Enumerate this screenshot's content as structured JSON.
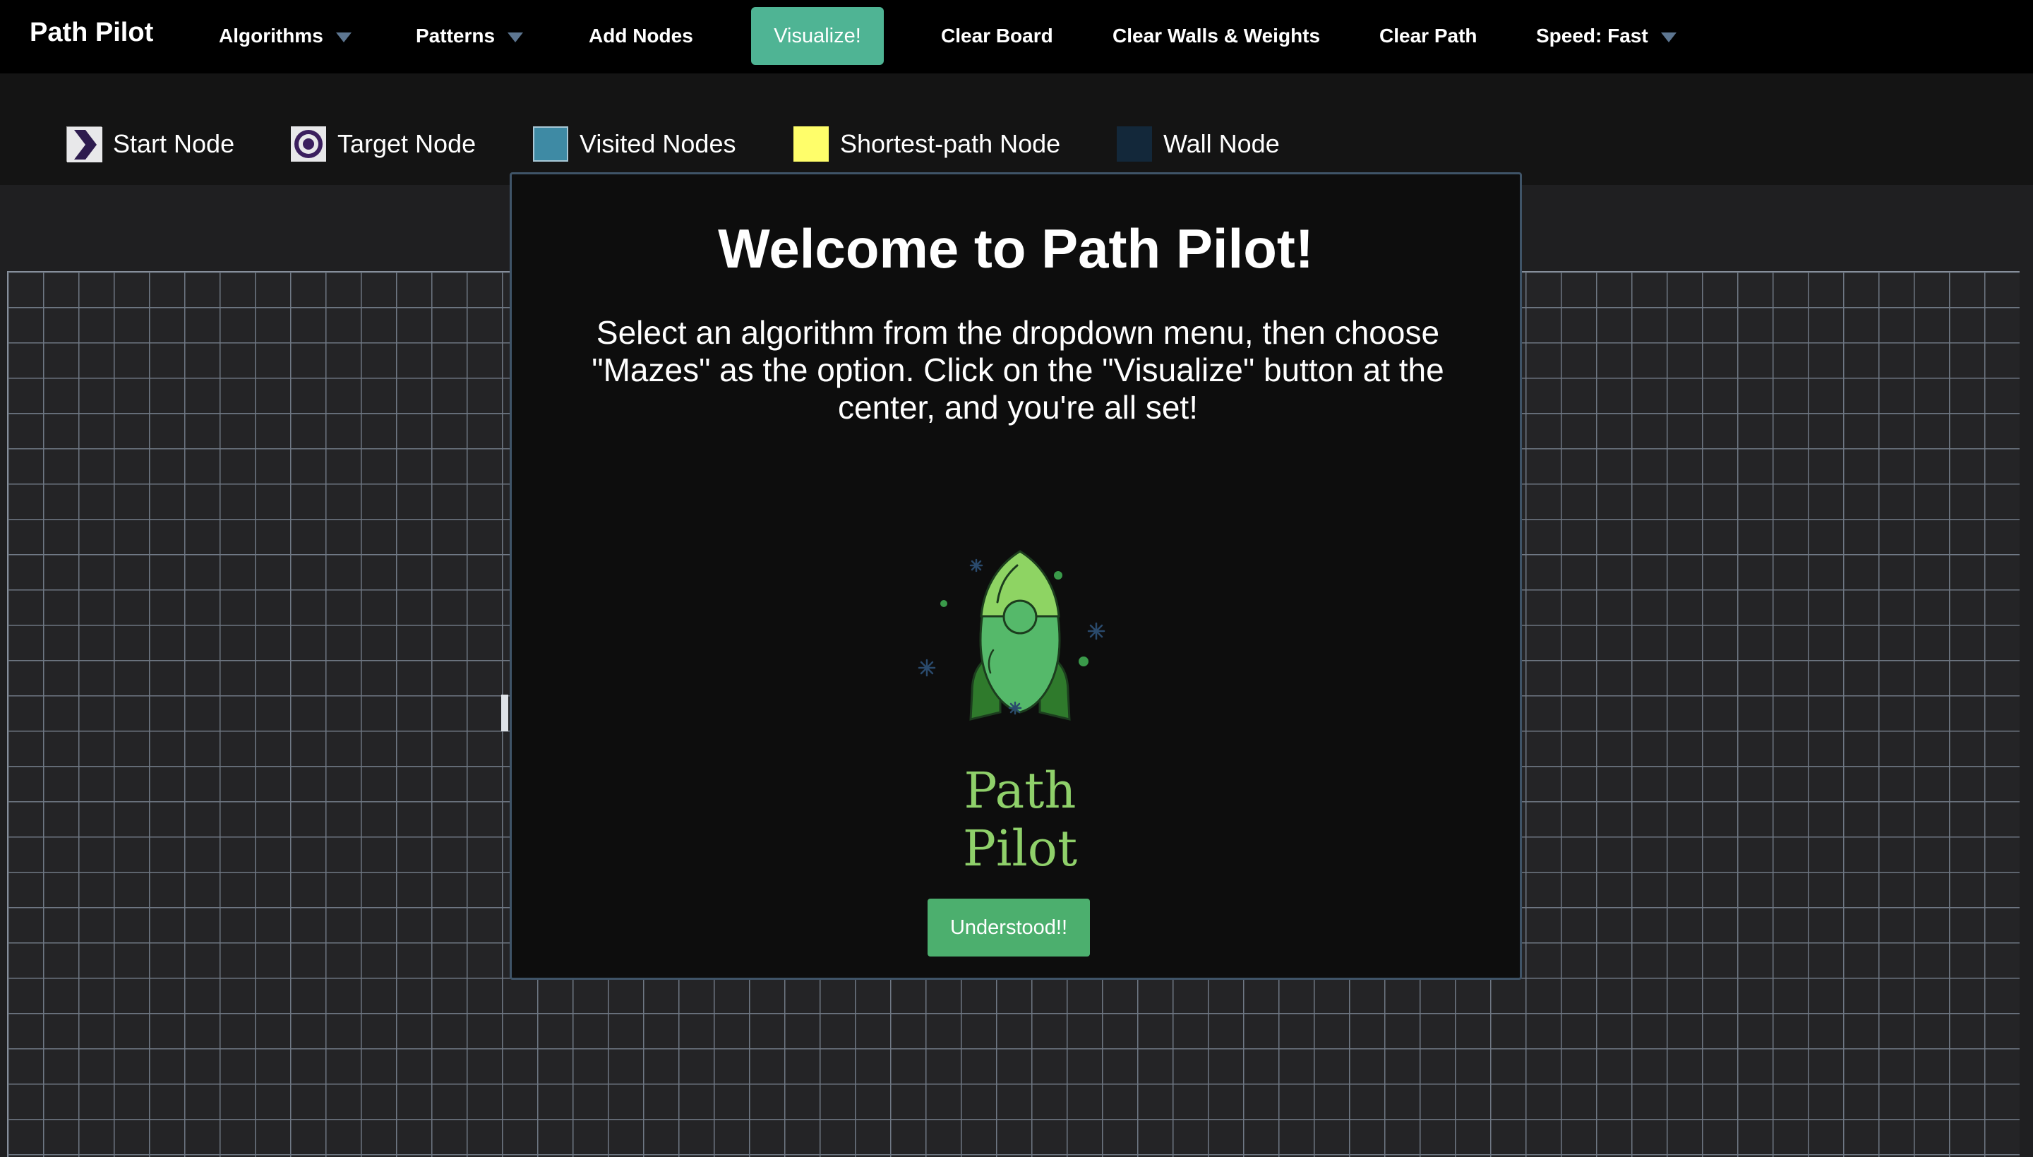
{
  "navbar": {
    "brand": "Path Pilot",
    "items": [
      {
        "label": "Algorithms",
        "dropdown": true
      },
      {
        "label": "Patterns",
        "dropdown": true
      },
      {
        "label": "Add Nodes",
        "dropdown": false
      },
      {
        "label": "Clear Board",
        "dropdown": false
      },
      {
        "label": "Clear Walls & Weights",
        "dropdown": false
      },
      {
        "label": "Clear Path",
        "dropdown": false
      },
      {
        "label": "Speed: Fast",
        "dropdown": true
      }
    ],
    "visualize_label": "Visualize!"
  },
  "legend": [
    {
      "label": "Start Node",
      "icon": "chevron-right-icon",
      "color": "#2d1b4e"
    },
    {
      "label": "Target Node",
      "icon": "target-icon",
      "color": "#3b1f5e"
    },
    {
      "label": "Visited Nodes",
      "icon": "square",
      "color": "#3e8aa4"
    },
    {
      "label": "Shortest-path Node",
      "icon": "square",
      "color": "#fffe6a"
    },
    {
      "label": "Wall Node",
      "icon": "square",
      "color": "#13283a"
    }
  ],
  "modal": {
    "title": "Welcome to Path Pilot!",
    "text": "Select an algorithm from the dropdown menu, then choose \"Mazes\" as the option. Click on the \"Visualize\" button at the center, and you're all set!",
    "logo_text": "Path Pilot",
    "logo_icon": "rocket-icon",
    "button_label": "Understood!!"
  },
  "colors": {
    "accent": "#4fb494",
    "button": "#4caf6e",
    "logo_text": "#8fd06a"
  }
}
